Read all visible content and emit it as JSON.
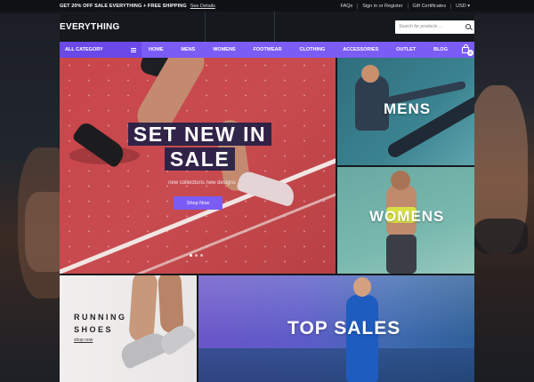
{
  "topbar": {
    "promo": "GET 20% OFF SALE EVERYTHING + FREE SHIPPING",
    "promo_link": "See Details",
    "links": [
      "FAQs",
      "Sign in or Register",
      "Gift Certificates",
      "USD ▾"
    ]
  },
  "header": {
    "logo": "EVERYTHING",
    "search_placeholder": "Search for products ..."
  },
  "nav": {
    "all_category": "ALL CATEGORY",
    "items": [
      "HOME",
      "MENS",
      "WOMENS",
      "FOOTWEAR",
      "CLOTHING",
      "ACCESSORIES",
      "OUTLET",
      "BLOG"
    ],
    "cart_count": "0"
  },
  "hero": {
    "title_line1": "SET NEW IN",
    "title_line2": "SALE",
    "subtitle": "new collections new designs",
    "button": "Shop Now"
  },
  "tiles": {
    "mens": "MENS",
    "womens": "WOMENS",
    "running_line1": "RUNNING",
    "running_line2": "SHOES",
    "running_link": "shop now",
    "top_sales": "TOP SALES"
  },
  "colors": {
    "accent": "#7b5cf5",
    "dark": "#15181d"
  }
}
